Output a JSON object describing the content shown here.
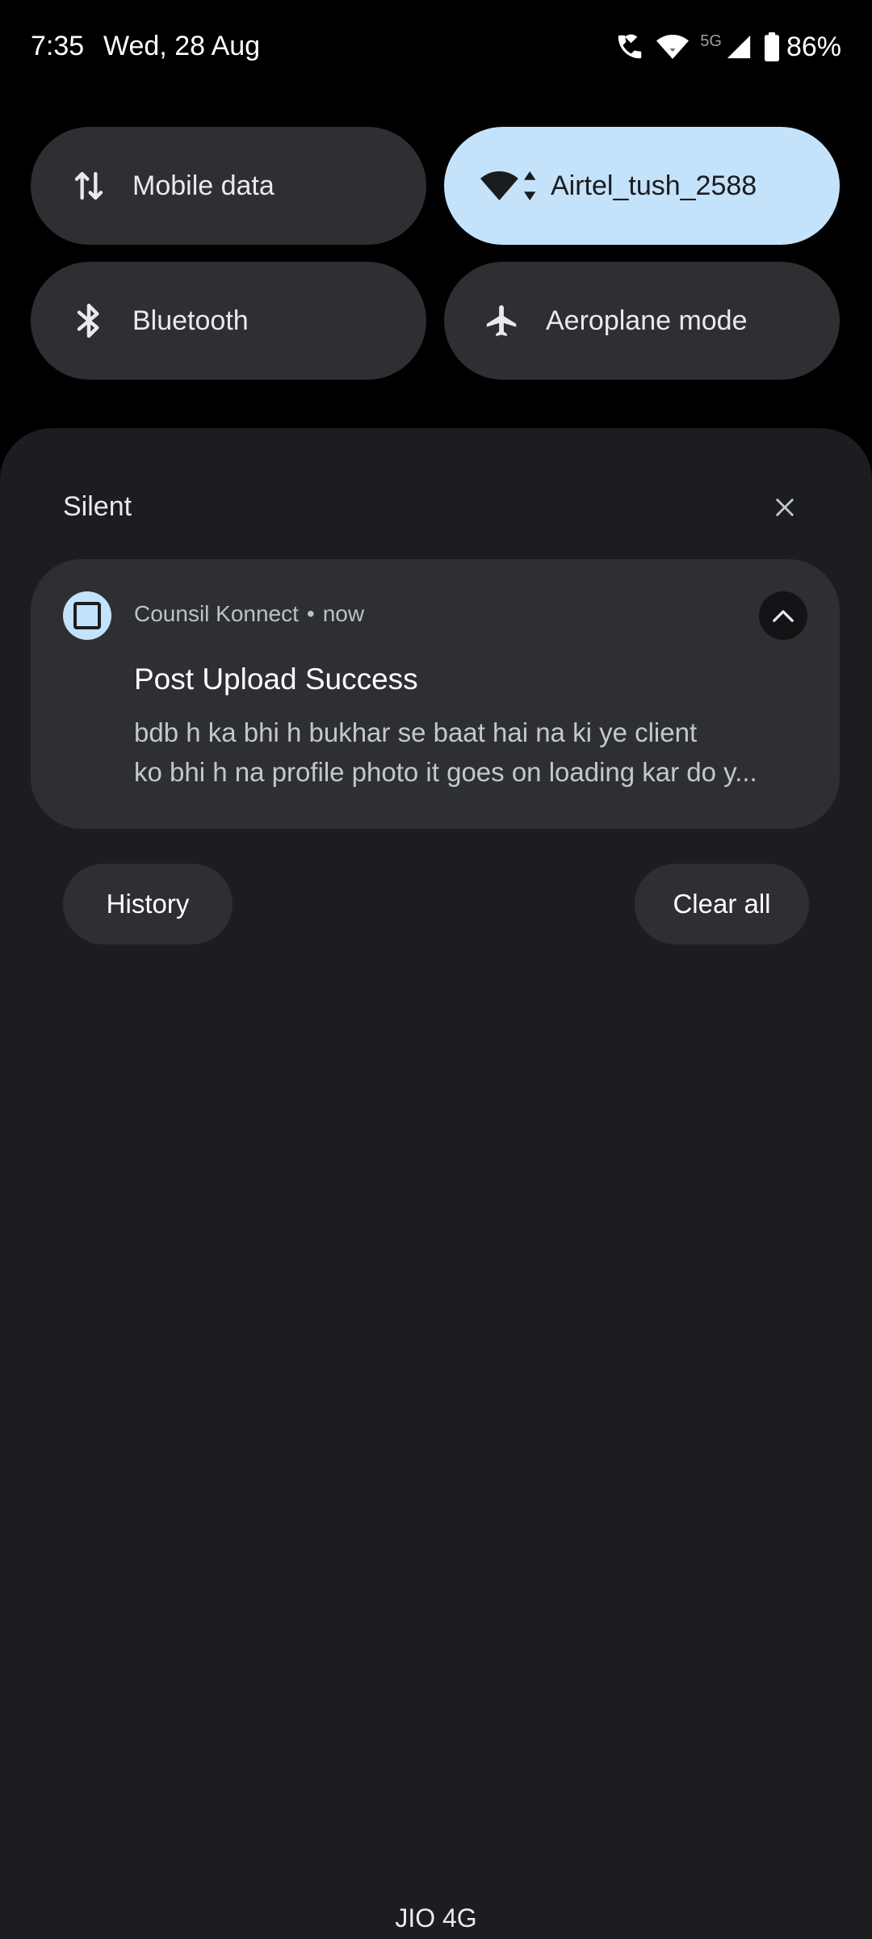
{
  "status_bar": {
    "time": "7:35",
    "date": "Wed, 28 Aug",
    "network_label": "5G",
    "battery": "86%",
    "icons": [
      "wifi-calling-icon",
      "wifi-icon",
      "cell-signal-icon",
      "battery-icon"
    ]
  },
  "quick_settings": {
    "tiles": [
      {
        "label": "Mobile data",
        "icon": "data-arrows-icon",
        "active": false
      },
      {
        "label": "Airtel_tush_2588",
        "icon": "wifi-icon",
        "active": true
      },
      {
        "label": "Bluetooth",
        "icon": "bluetooth-icon",
        "active": false
      },
      {
        "label": "Aeroplane mode",
        "icon": "airplane-icon",
        "active": false
      }
    ]
  },
  "notifications": {
    "section_title": "Silent",
    "items": [
      {
        "app_name": "Counsil Konnect",
        "separator": "•",
        "time": "now",
        "title": "Post Upload Success",
        "body_line1": "bdb h ka bhi h bukhar se baat hai na ki ye client",
        "body_line2": "ko bhi h na profile photo it goes on loading kar do y..."
      }
    ],
    "history_label": "History",
    "clear_all_label": "Clear all"
  },
  "footer": {
    "carrier": "JIO 4G"
  },
  "colors": {
    "background": "#000000",
    "shade": "#1b1d20",
    "tile": "#2d2f33",
    "tile_active": "#c5e2fb"
  }
}
